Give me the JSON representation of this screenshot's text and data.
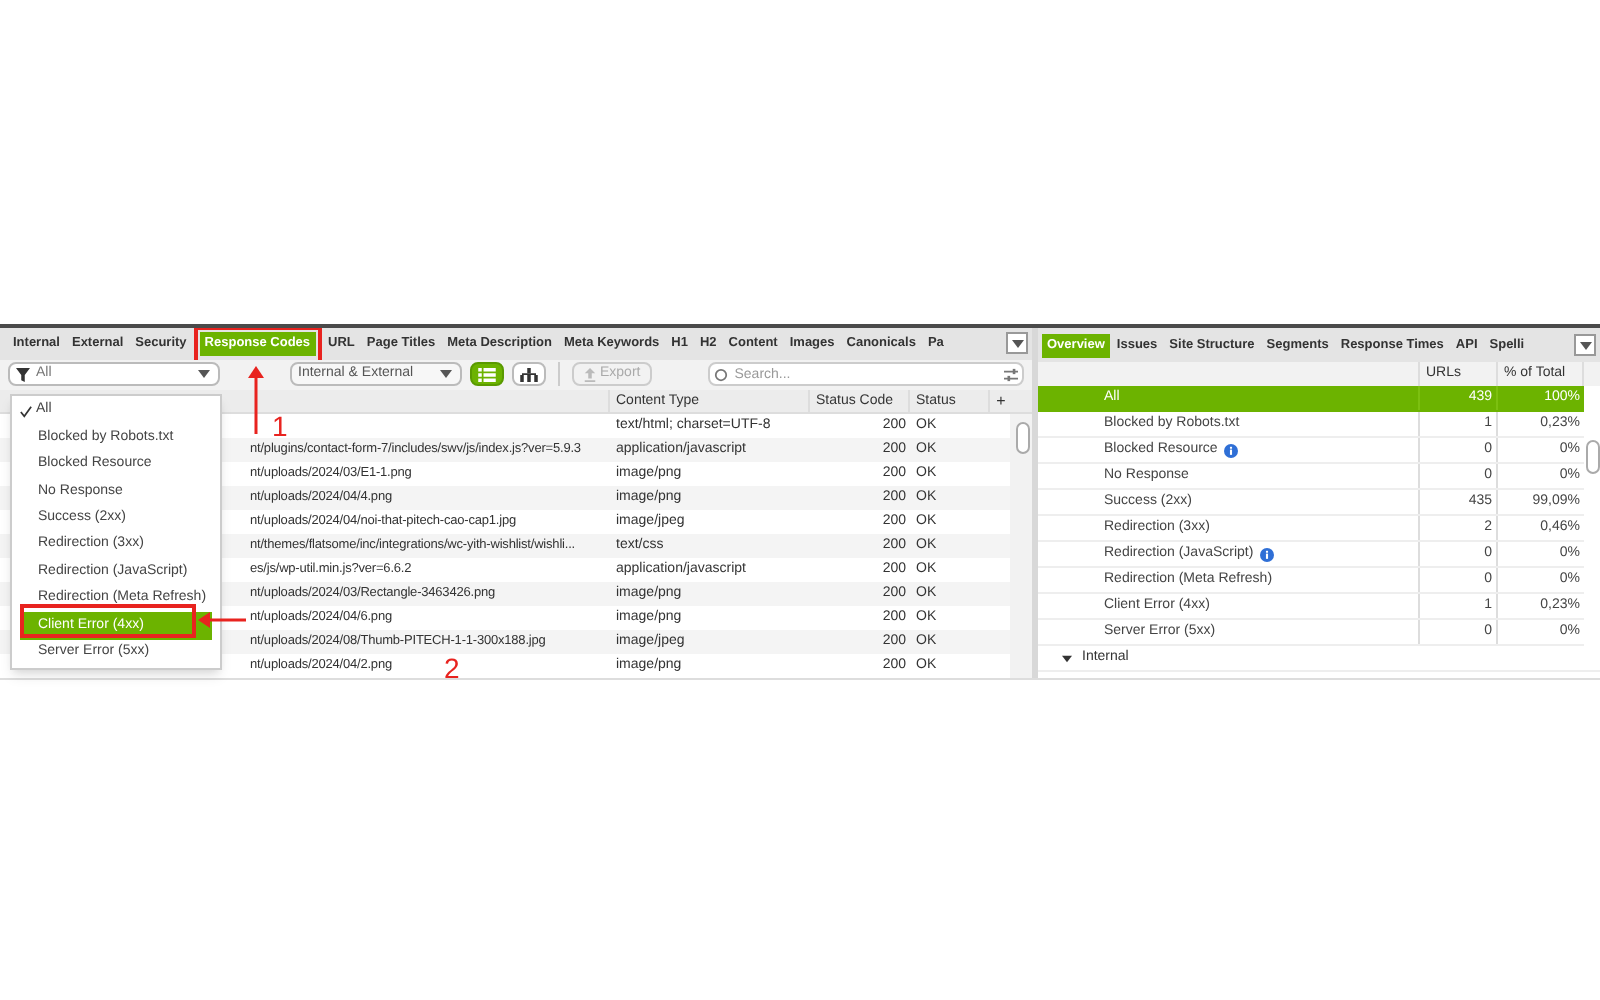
{
  "left_tabs": [
    {
      "label": "Internal",
      "selected": false
    },
    {
      "label": "External",
      "selected": false
    },
    {
      "label": "Security",
      "selected": false
    },
    {
      "label": "Response Codes",
      "selected": true
    },
    {
      "label": "URL",
      "selected": false
    },
    {
      "label": "Page Titles",
      "selected": false
    },
    {
      "label": "Meta Description",
      "selected": false
    },
    {
      "label": "Meta Keywords",
      "selected": false
    },
    {
      "label": "H1",
      "selected": false
    },
    {
      "label": "H2",
      "selected": false
    },
    {
      "label": "Content",
      "selected": false
    },
    {
      "label": "Images",
      "selected": false
    },
    {
      "label": "Canonicals",
      "selected": false
    },
    {
      "label": "Pa",
      "selected": false
    }
  ],
  "filter": {
    "value": "All"
  },
  "scope": {
    "value": "Internal & External"
  },
  "view_buttons": [
    {
      "kind": "list",
      "selected": true
    },
    {
      "kind": "tree",
      "selected": false
    }
  ],
  "export": {
    "label": "Export",
    "disabled": true
  },
  "search": {
    "placeholder": "Search..."
  },
  "table": {
    "columns": [
      "Content Type",
      "Status Code",
      "Status"
    ],
    "add_column": "+",
    "rows": [
      {
        "address": "",
        "content_type": "text/html; charset=UTF-8",
        "status_code": "200",
        "status": "OK"
      },
      {
        "address": "nt/plugins/contact-form-7/includes/swv/js/index.js?ver=5.9.3",
        "content_type": "application/javascript",
        "status_code": "200",
        "status": "OK"
      },
      {
        "address": "nt/uploads/2024/03/E1-1.png",
        "content_type": "image/png",
        "status_code": "200",
        "status": "OK"
      },
      {
        "address": "nt/uploads/2024/04/4.png",
        "content_type": "image/png",
        "status_code": "200",
        "status": "OK"
      },
      {
        "address": "nt/uploads/2024/04/noi-that-pitech-cao-cap1.jpg",
        "content_type": "image/jpeg",
        "status_code": "200",
        "status": "OK"
      },
      {
        "address": "nt/themes/flatsome/inc/integrations/wc-yith-wishlist/wishli...",
        "content_type": "text/css",
        "status_code": "200",
        "status": "OK"
      },
      {
        "address": "es/js/wp-util.min.js?ver=6.6.2",
        "content_type": "application/javascript",
        "status_code": "200",
        "status": "OK"
      },
      {
        "address": "nt/uploads/2024/03/Rectangle-3463426.png",
        "content_type": "image/png",
        "status_code": "200",
        "status": "OK"
      },
      {
        "address": "nt/uploads/2024/04/6.png",
        "content_type": "image/png",
        "status_code": "200",
        "status": "OK"
      },
      {
        "address": "nt/uploads/2024/08/Thumb-PITECH-1-1-300x188.jpg",
        "content_type": "image/jpeg",
        "status_code": "200",
        "status": "OK"
      },
      {
        "address": "nt/uploads/2024/04/2.png",
        "content_type": "image/png",
        "status_code": "200",
        "status": "OK"
      }
    ]
  },
  "filter_menu": [
    {
      "label": "All",
      "checked": true,
      "selected": false
    },
    {
      "label": "Blocked by Robots.txt",
      "checked": false,
      "selected": false
    },
    {
      "label": "Blocked Resource",
      "checked": false,
      "selected": false
    },
    {
      "label": "No Response",
      "checked": false,
      "selected": false
    },
    {
      "label": "Success (2xx)",
      "checked": false,
      "selected": false
    },
    {
      "label": "Redirection (3xx)",
      "checked": false,
      "selected": false
    },
    {
      "label": "Redirection (JavaScript)",
      "checked": false,
      "selected": false
    },
    {
      "label": "Redirection (Meta Refresh)",
      "checked": false,
      "selected": false
    },
    {
      "label": "Client Error (4xx)",
      "checked": false,
      "selected": true
    },
    {
      "label": "Server Error (5xx)",
      "checked": false,
      "selected": false
    }
  ],
  "right_tabs": [
    {
      "label": "Overview",
      "selected": true
    },
    {
      "label": "Issues",
      "selected": false
    },
    {
      "label": "Site Structure",
      "selected": false
    },
    {
      "label": "Segments",
      "selected": false
    },
    {
      "label": "Response Times",
      "selected": false
    },
    {
      "label": "API",
      "selected": false
    },
    {
      "label": "Spelli",
      "selected": false
    }
  ],
  "overview": {
    "columns": [
      "URLs",
      "% of Total"
    ],
    "rows": [
      {
        "kind": "item",
        "label": "All",
        "urls": "439",
        "percent": "100%",
        "info": false,
        "selected": true
      },
      {
        "kind": "item",
        "label": "Blocked by Robots.txt",
        "urls": "1",
        "percent": "0,23%",
        "info": false,
        "selected": false
      },
      {
        "kind": "item",
        "label": "Blocked Resource",
        "urls": "0",
        "percent": "0%",
        "info": true,
        "selected": false
      },
      {
        "kind": "item",
        "label": "No Response",
        "urls": "0",
        "percent": "0%",
        "info": false,
        "selected": false
      },
      {
        "kind": "item",
        "label": "Success (2xx)",
        "urls": "435",
        "percent": "99,09%",
        "info": false,
        "selected": false
      },
      {
        "kind": "item",
        "label": "Redirection (3xx)",
        "urls": "2",
        "percent": "0,46%",
        "info": false,
        "selected": false
      },
      {
        "kind": "item",
        "label": "Redirection (JavaScript)",
        "urls": "0",
        "percent": "0%",
        "info": true,
        "selected": false
      },
      {
        "kind": "item",
        "label": "Redirection (Meta Refresh)",
        "urls": "0",
        "percent": "0%",
        "info": false,
        "selected": false
      },
      {
        "kind": "item",
        "label": "Client Error (4xx)",
        "urls": "1",
        "percent": "0,23%",
        "info": false,
        "selected": false
      },
      {
        "kind": "item",
        "label": "Server Error (5xx)",
        "urls": "0",
        "percent": "0%",
        "info": false,
        "selected": false
      },
      {
        "kind": "group",
        "label": "Internal",
        "expanded": true
      }
    ]
  },
  "annotations": [
    {
      "label": "1"
    },
    {
      "label": "2"
    }
  ]
}
